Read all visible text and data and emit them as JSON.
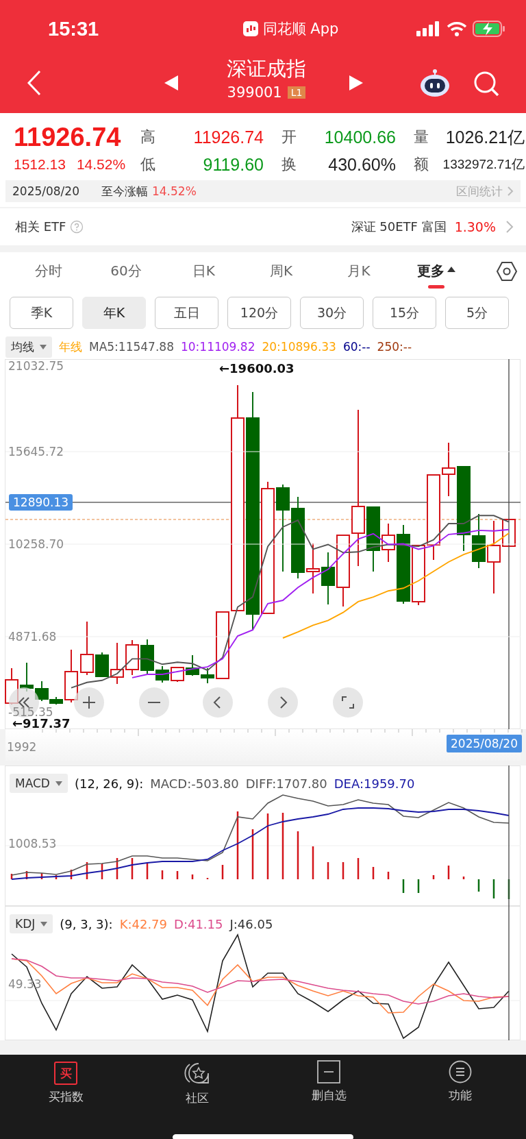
{
  "status_bar": {
    "time": "15:31",
    "app_name": "同花顺 App"
  },
  "header": {
    "title": "深证成指",
    "code": "399001",
    "level_badge": "L1"
  },
  "quote": {
    "price": "11926.74",
    "change": "1512.13",
    "change_pct": "14.52%",
    "stats": [
      {
        "label": "高",
        "value": "11926.74",
        "color": "#f21b1b"
      },
      {
        "label": "开",
        "value": "10400.66",
        "color": "#0c9a1c"
      },
      {
        "label": "量",
        "value": "1026.21亿",
        "color": "#222222"
      },
      {
        "label": "低",
        "value": "9119.60",
        "color": "#0c9a1c"
      },
      {
        "label": "换",
        "value": "430.60%",
        "color": "#222222"
      },
      {
        "label": "额",
        "value": "1332972.71亿",
        "color": "#222222"
      }
    ]
  },
  "range_bar": {
    "date": "2025/08/20",
    "label": "至今涨幅",
    "value": "14.52%",
    "link": "区间统计"
  },
  "etf": {
    "label": "相关 ETF",
    "fund": "深证 50ETF 富国",
    "change": "1.30%"
  },
  "period_tabs": [
    {
      "label": "分时",
      "kind": "tab",
      "selected": false
    },
    {
      "label": "60分",
      "kind": "tab",
      "selected": false
    },
    {
      "label": "日K",
      "kind": "tab",
      "selected": false
    },
    {
      "label": "周K",
      "kind": "tab",
      "selected": false
    },
    {
      "label": "月K",
      "kind": "tab",
      "selected": false
    },
    {
      "label": "更多",
      "kind": "menu",
      "selected": true
    }
  ],
  "sub_periods": [
    {
      "label": "季K",
      "selected": false
    },
    {
      "label": "年K",
      "selected": true
    },
    {
      "label": "五日",
      "selected": false
    },
    {
      "label": "120分",
      "selected": false
    },
    {
      "label": "30分",
      "selected": false
    },
    {
      "label": "15分",
      "selected": false
    },
    {
      "label": "5分",
      "selected": false
    }
  ],
  "ma_legend": {
    "selector": "均线",
    "period": "年线",
    "items": [
      {
        "label": "60:--",
        "color": "#00008b"
      },
      {
        "label": "250:--",
        "color": "#a0390f"
      }
    ]
  },
  "main_chart": {
    "chart_data": {
      "type": "line",
      "ylim": [
        -515.35,
        21032.75
      ],
      "grid": true,
      "yticks": [
        {
          "value": 21032.75,
          "label": "21032.75"
        },
        {
          "value": 15645.72,
          "label": "15645.72"
        },
        {
          "value": 10258.7,
          "label": "10258.70"
        },
        {
          "value": 4871.68,
          "label": "4871.68"
        }
      ],
      "series": [
        {
          "name": "MA5:11547.88",
          "color": "#555555",
          "values": [
            null,
            null,
            null,
            null,
            1894,
            2208,
            2325,
            2717,
            3579,
            3579,
            3265,
            3383,
            3305,
            2913,
            3657,
            6596,
            7183,
            10122,
            11258,
            11650,
            9965,
            10239,
            9769,
            9808,
            10083,
            10239,
            10200,
            10122,
            10514,
            11454,
            11454,
            11924,
            11924,
            11548
          ]
        },
        {
          "name": "10:11109.82",
          "color": "#a020f0",
          "values": [
            null,
            null,
            null,
            null,
            null,
            null,
            null,
            null,
            2482,
            2678,
            2678,
            2835,
            2991,
            3109,
            3579,
            4911,
            5264,
            6792,
            6988,
            7732,
            8320,
            8790,
            9691,
            10553,
            10867,
            10239,
            10279,
            9965,
            10161,
            10827,
            10906,
            11062,
            11023,
            11110
          ]
        },
        {
          "name": "20:10896.33",
          "color": "#ffa500",
          "values": [
            null,
            null,
            null,
            null,
            null,
            null,
            null,
            null,
            null,
            null,
            null,
            null,
            null,
            null,
            null,
            null,
            null,
            null,
            4793,
            5146,
            5538,
            5812,
            6282,
            6909,
            7183,
            7536,
            7693,
            8124,
            8672,
            9221,
            9652,
            9965,
            10279,
            10896
          ]
        }
      ]
    },
    "bottom_label": "-515.35",
    "crosshair_value": "12890.13",
    "high_marker": "←19600.03",
    "low_marker": "←917.37",
    "start_label": "1992",
    "crosshair_date": "2025/08/20"
  },
  "macd": {
    "selector": "MACD",
    "params": "(12, 26, 9):",
    "values": [
      {
        "label": "MACD:-503.80",
        "color": "#555555"
      },
      {
        "label": "DIFF:1707.80",
        "color": "#555555"
      },
      {
        "label": "DEA:1959.70",
        "color": "#1a1aa6"
      }
    ],
    "y_label": "1008.53"
  },
  "kdj": {
    "selector": "KDJ",
    "params": "(9, 3, 3):",
    "values": [
      {
        "label": "K:42.79",
        "color": "#ff7f3f"
      },
      {
        "label": "D:41.15",
        "color": "#dc4c8c"
      },
      {
        "label": "J:46.05",
        "color": "#333333"
      }
    ],
    "y_label": "49.33"
  },
  "bottom_nav": [
    {
      "label": "买指数",
      "kind": "buy",
      "badge": "买"
    },
    {
      "label": "社区",
      "kind": "community"
    },
    {
      "label": "删自选",
      "kind": "remove"
    },
    {
      "label": "功能",
      "kind": "functions"
    }
  ]
}
